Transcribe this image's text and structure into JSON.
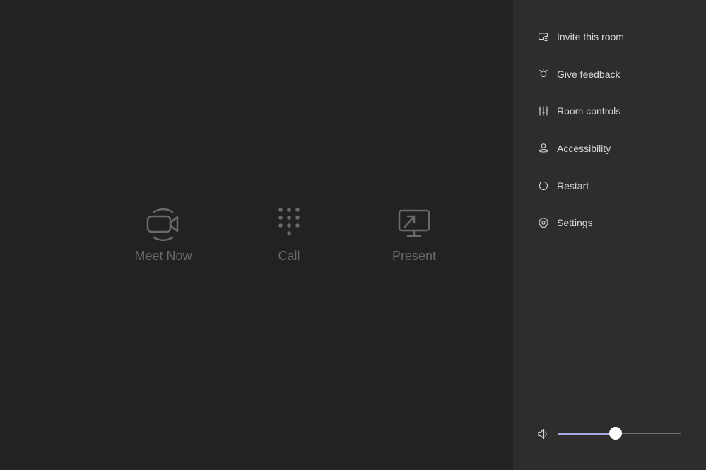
{
  "main": {
    "actions": [
      {
        "label": "Meet Now",
        "icon": "video-camera-icon"
      },
      {
        "label": "Call",
        "icon": "dialpad-icon"
      },
      {
        "label": "Present",
        "icon": "share-screen-icon"
      }
    ]
  },
  "panel": {
    "menu": [
      {
        "label": "Invite this room",
        "icon": "cast-icon"
      },
      {
        "label": "Give feedback",
        "icon": "lightbulb-icon"
      },
      {
        "label": "Room controls",
        "icon": "sliders-icon"
      },
      {
        "label": "Accessibility",
        "icon": "accessibility-icon"
      },
      {
        "label": "Restart",
        "icon": "restart-icon"
      },
      {
        "label": "Settings",
        "icon": "gear-icon"
      }
    ],
    "volume": {
      "icon": "speaker-icon",
      "level": 0.47
    }
  },
  "colors": {
    "background": "#232221",
    "panel": "#2e2d2c",
    "muted_text": "#6b6a69",
    "menu_text": "#d8d6d4",
    "accent": "#a4a6e6"
  }
}
